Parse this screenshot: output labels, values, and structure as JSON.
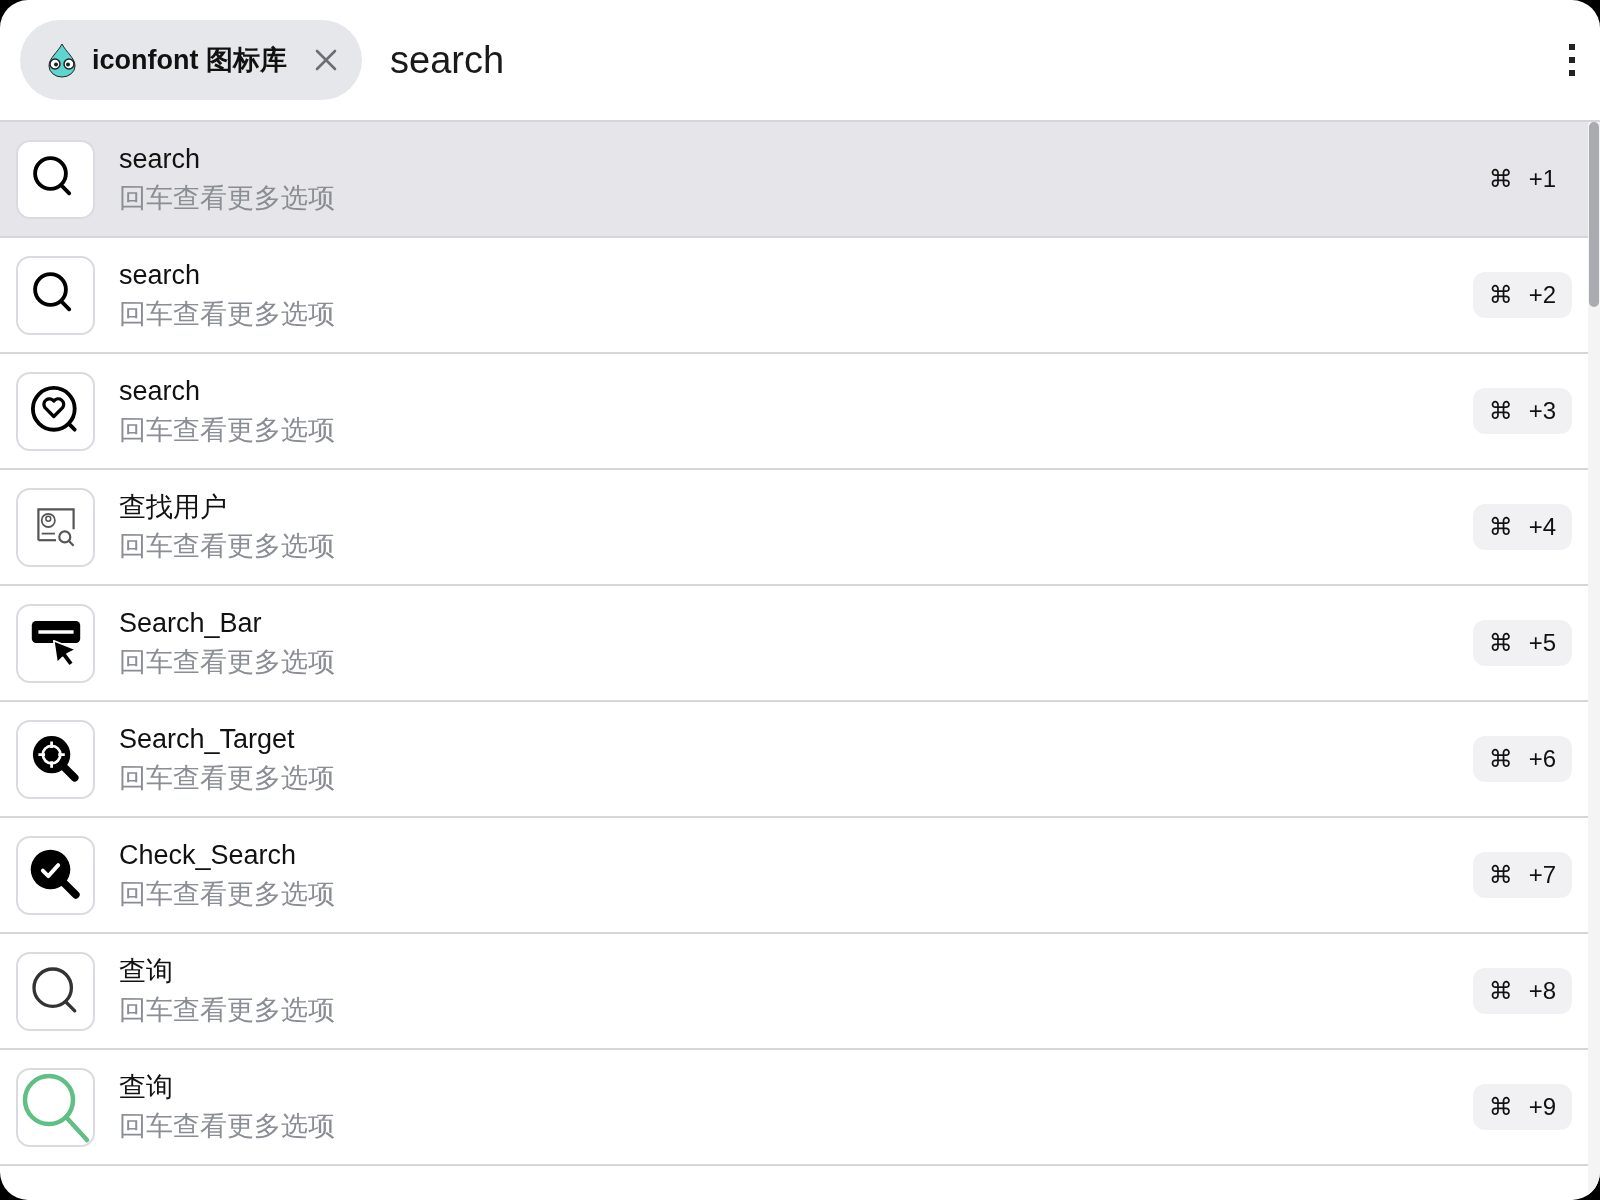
{
  "search_bar": {
    "source_chip": {
      "label": "iconfont 图标库"
    },
    "query": "search"
  },
  "results": [
    {
      "title": "search",
      "subtitle": "回车查看更多选项",
      "shortcut_key": "⌘",
      "shortcut": "+1",
      "selected": true
    },
    {
      "title": "search",
      "subtitle": "回车查看更多选项",
      "shortcut_key": "⌘",
      "shortcut": "+2",
      "selected": false
    },
    {
      "title": "search",
      "subtitle": "回车查看更多选项",
      "shortcut_key": "⌘",
      "shortcut": "+3",
      "selected": false
    },
    {
      "title": "查找用户",
      "subtitle": "回车查看更多选项",
      "shortcut_key": "⌘",
      "shortcut": "+4",
      "selected": false
    },
    {
      "title": "Search_Bar",
      "subtitle": "回车查看更多选项",
      "shortcut_key": "⌘",
      "shortcut": "+5",
      "selected": false
    },
    {
      "title": "Search_Target",
      "subtitle": "回车查看更多选项",
      "shortcut_key": "⌘",
      "shortcut": "+6",
      "selected": false
    },
    {
      "title": "Check_Search",
      "subtitle": "回车查看更多选项",
      "shortcut_key": "⌘",
      "shortcut": "+7",
      "selected": false
    },
    {
      "title": "查询",
      "subtitle": "回车查看更多选项",
      "shortcut_key": "⌘",
      "shortcut": "+8",
      "selected": false
    },
    {
      "title": "查询",
      "subtitle": "回车查看更多选项",
      "shortcut_key": "⌘",
      "shortcut": "+9",
      "selected": false
    }
  ]
}
